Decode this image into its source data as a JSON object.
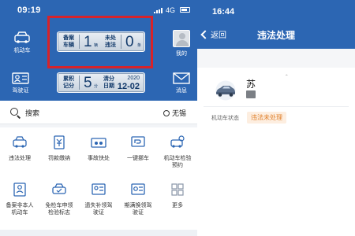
{
  "left": {
    "status": {
      "time": "09:19",
      "network": "4G"
    },
    "side_buttons": {
      "vehicle": "机动车",
      "mine": "我的",
      "license": "驾驶证",
      "message": "消息"
    },
    "vehicle_plate": {
      "label_registered": "备案\n车辆",
      "registered_count": "1",
      "registered_unit": "辆",
      "label_violations": "未处\n违法",
      "violation_count": "0",
      "violation_unit": "条"
    },
    "license_plate": {
      "label_points": "累积\n记分",
      "points": "5",
      "points_unit": "分",
      "label_clear_date": "清分\n日期",
      "clear_year": "2020",
      "clear_date": "12-02"
    },
    "search": {
      "placeholder": "搜索",
      "location": "无锡"
    },
    "grid": [
      {
        "label": "违法处理",
        "icon": "violation-car-icon"
      },
      {
        "label": "罚款缴纳",
        "icon": "fine-payment-icon"
      },
      {
        "label": "事故快处",
        "icon": "accident-icon"
      },
      {
        "label": "一键挪车",
        "icon": "move-car-icon"
      },
      {
        "label": "机动车检验预约",
        "icon": "inspection-icon"
      },
      {
        "label": "备案非本人机动车",
        "icon": "register-other-car-icon"
      },
      {
        "label": "免检车申领检验标志",
        "icon": "exempt-inspection-icon"
      },
      {
        "label": "遗失补领驾驶证",
        "icon": "reissue-license-icon"
      },
      {
        "label": "期满换领驾驶证",
        "icon": "renew-license-icon"
      },
      {
        "label": "更多",
        "icon": "more-grid-icon"
      }
    ]
  },
  "right": {
    "status": {
      "time": "16:44"
    },
    "back": "返回",
    "title": "违法处理",
    "plate_prefix": "苏",
    "vehicle_state_label": "机动车状态",
    "vehicle_state": "违法未处理"
  },
  "colors": {
    "primary": "#2c66b3",
    "highlight": "#d6232a",
    "badge_text": "#e0802c",
    "badge_bg": "#fdeee0"
  }
}
